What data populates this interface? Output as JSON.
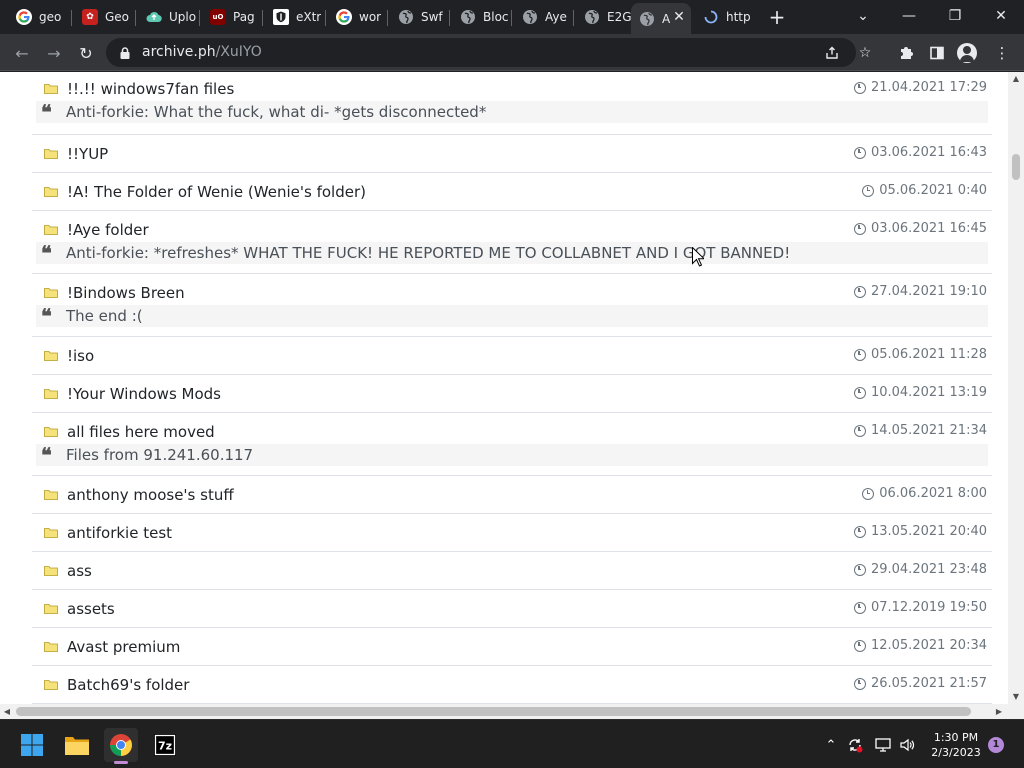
{
  "tabs": [
    {
      "title": "geo",
      "icon": "google-icon"
    },
    {
      "title": "Geo",
      "icon": "red-app-icon"
    },
    {
      "title": "Uplo",
      "icon": "cloud-icon"
    },
    {
      "title": "Pag",
      "icon": "ublock-icon"
    },
    {
      "title": "eXtr",
      "icon": "shield-icon"
    },
    {
      "title": "wor",
      "icon": "google-icon"
    },
    {
      "title": "Swf",
      "icon": "globe-icon"
    },
    {
      "title": "Bloc",
      "icon": "globe-icon"
    },
    {
      "title": "Aye",
      "icon": "globe-icon"
    },
    {
      "title": "E2G",
      "icon": "globe-icon"
    },
    {
      "title": "A",
      "icon": "globe-icon",
      "active": true
    },
    {
      "title": "http",
      "icon": "loading-spinner-icon"
    }
  ],
  "toolbar": {
    "url_host": "archive.ph",
    "url_path": "/XuIYO"
  },
  "files": [
    {
      "name": "!!.!! windows7fan files",
      "date": "21.04.2021 17:29",
      "comment": "Anti-forkie: What the fuck, what di- *gets disconnected*"
    },
    {
      "name": "!!YUP",
      "date": "03.06.2021 16:43"
    },
    {
      "name": "!A! The Folder of Wenie (Wenie's folder)",
      "date": "05.06.2021 0:40"
    },
    {
      "name": "!Aye folder",
      "date": "03.06.2021 16:45",
      "comment": "Anti-forkie: *refreshes* WHAT THE FUCK! HE REPORTED ME TO COLLABNET AND I GOT BANNED!"
    },
    {
      "name": "!Bindows Breen",
      "date": "27.04.2021 19:10",
      "comment": "The end :("
    },
    {
      "name": "!iso",
      "date": "05.06.2021 11:28"
    },
    {
      "name": "!Your Windows Mods",
      "date": "10.04.2021 13:19"
    },
    {
      "name": "all files here moved",
      "date": "14.05.2021 21:34",
      "comment": "Files from 91.241.60.117"
    },
    {
      "name": "anthony moose's stuff",
      "date": "06.06.2021 8:00"
    },
    {
      "name": "antiforkie test",
      "date": "13.05.2021 20:40"
    },
    {
      "name": "ass",
      "date": "29.04.2021 23:48"
    },
    {
      "name": "assets",
      "date": "07.12.2019 19:50"
    },
    {
      "name": "Avast premium",
      "date": "12.05.2021 20:34"
    },
    {
      "name": "Batch69's folder",
      "date": "26.05.2021 21:57"
    }
  ],
  "taskbar": {
    "time": "1:30 PM",
    "date": "2/3/2023",
    "notification_count": "1",
    "apps": [
      "windows-start-icon",
      "file-explorer-icon",
      "chrome-icon",
      "7zip-icon"
    ]
  },
  "colors": {
    "folder": "#f5e27a",
    "row_border": "#dee2e6",
    "quote_bg": "#f5f5f5",
    "date_text": "#6c757d"
  }
}
